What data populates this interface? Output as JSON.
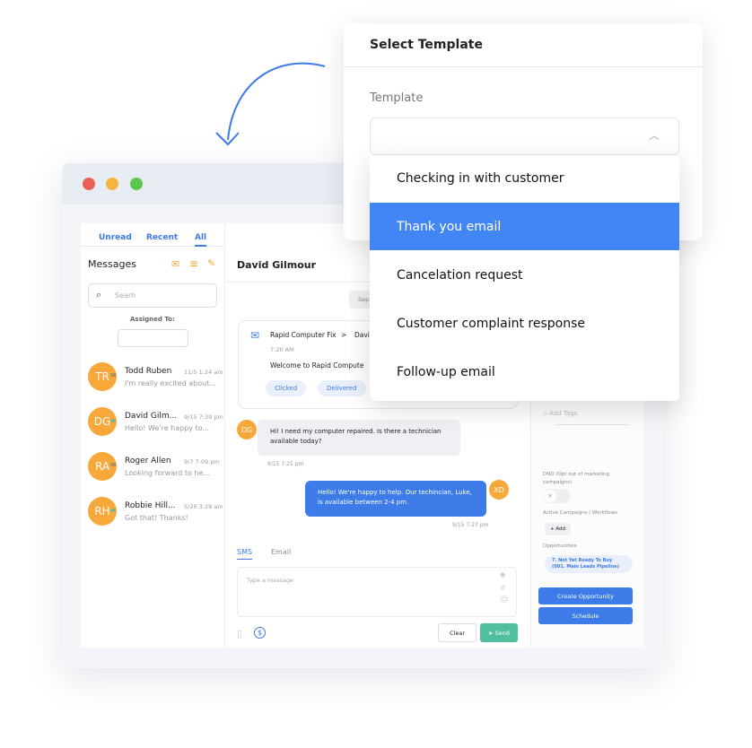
{
  "window": {
    "dots": [
      "#ec5f57",
      "#f4b43f",
      "#5ec54d"
    ]
  },
  "sidebar": {
    "tabs": [
      "Unread",
      "Recent",
      "All"
    ],
    "title": "Messages",
    "search_placeholder": "Searh",
    "assigned_label": "Assigned To:",
    "items": [
      {
        "initials": "TR",
        "name": "Todd Ruben",
        "time": "11/5 1:24 am",
        "preview": "I'm really excited about...",
        "channel": "email"
      },
      {
        "initials": "DG",
        "name": "David Gilm...",
        "time": "9/15 7:39 pm",
        "preview": "Hello! We're happy to...",
        "channel": "sms"
      },
      {
        "initials": "RA",
        "name": "Roger Allen",
        "time": "9/7 7:09 pm",
        "preview": "Looking forward to he...",
        "channel": "email"
      },
      {
        "initials": "RH",
        "name": "Robbie Hill...",
        "time": "5/20 3:29 am",
        "preview": "Got that! Thanks!",
        "channel": "sms"
      }
    ]
  },
  "chat": {
    "contact": "David Gilmour",
    "date_pill": "Sep",
    "email_card": {
      "from": "Rapid Computer Fix",
      "arrow": ">",
      "to": "Davi",
      "time": "7:20 AM",
      "subject": "Welcome to Rapid Compute",
      "badges": [
        "Clicked",
        "Delivered"
      ]
    },
    "messages": [
      {
        "initials": "DG",
        "text": "Hi! I need my computer repaired. Is there a technician available today?",
        "time": "9/15 7:25 pm"
      },
      {
        "initials": "XD",
        "text": "Hello! We're happy to help. Our techincian, Luke, is available between 2-4 pm.",
        "time": "9/15 7:27 pm"
      }
    ],
    "compose_tabs": [
      "SMS",
      "Email"
    ],
    "compose_placeholder": "Type a message",
    "clear": "Clear",
    "send": "Send"
  },
  "contact_panel": {
    "add_tags": "Add Tags",
    "dnd": "DND (Opt out of marketing campaigns)",
    "campaigns": "Active Campaigns / Workflows",
    "add": "+ Add",
    "opportunities": "Opportunities",
    "opportunity": "7. Not Yet Ready To Buy (001. Main Leads Pipeline)",
    "create": "Create Opportunity",
    "schedule": "Schedule"
  },
  "modal": {
    "title": "Select Template",
    "label": "Template",
    "options": [
      "Checking in with customer",
      "Thank you email",
      "Cancelation request",
      "Customer complaint response",
      "Follow-up email"
    ],
    "selected_index": 1,
    "accent": "#4285f4"
  }
}
